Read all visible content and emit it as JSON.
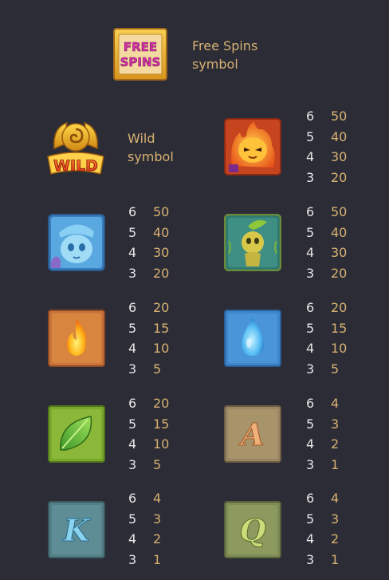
{
  "free_spins": {
    "icon_text_line1": "FREE",
    "icon_text_line2": "SPINS",
    "label_line1": "Free Spins",
    "label_line2": "symbol"
  },
  "wild": {
    "icon_text": "WILD",
    "label_line1": "Wild",
    "label_line2": "symbol"
  },
  "symbols": [
    {
      "id": "fire-spirit",
      "icon": "fire-spirit-icon",
      "color": "#f07a1c",
      "payouts": [
        {
          "count": "6",
          "value": "50"
        },
        {
          "count": "5",
          "value": "40"
        },
        {
          "count": "4",
          "value": "30"
        },
        {
          "count": "3",
          "value": "20"
        }
      ]
    },
    {
      "id": "water-spirit",
      "icon": "water-spirit-icon",
      "color": "#5ab4e8",
      "payouts": [
        {
          "count": "6",
          "value": "50"
        },
        {
          "count": "5",
          "value": "40"
        },
        {
          "count": "4",
          "value": "30"
        },
        {
          "count": "3",
          "value": "20"
        }
      ]
    },
    {
      "id": "leaf-spirit",
      "icon": "leaf-spirit-icon",
      "color": "#4a9a7a",
      "payouts": [
        {
          "count": "6",
          "value": "50"
        },
        {
          "count": "5",
          "value": "40"
        },
        {
          "count": "4",
          "value": "30"
        },
        {
          "count": "3",
          "value": "20"
        }
      ]
    },
    {
      "id": "fire",
      "icon": "fire-icon",
      "color": "#d8722c",
      "payouts": [
        {
          "count": "6",
          "value": "20"
        },
        {
          "count": "5",
          "value": "15"
        },
        {
          "count": "4",
          "value": "10"
        },
        {
          "count": "3",
          "value": "5"
        }
      ]
    },
    {
      "id": "water",
      "icon": "water-drop-icon",
      "color": "#3f8ed6",
      "payouts": [
        {
          "count": "6",
          "value": "20"
        },
        {
          "count": "5",
          "value": "15"
        },
        {
          "count": "4",
          "value": "10"
        },
        {
          "count": "3",
          "value": "5"
        }
      ]
    },
    {
      "id": "leaf",
      "icon": "leaf-icon",
      "color": "#8cb83a",
      "payouts": [
        {
          "count": "6",
          "value": "20"
        },
        {
          "count": "5",
          "value": "15"
        },
        {
          "count": "4",
          "value": "10"
        },
        {
          "count": "3",
          "value": "5"
        }
      ]
    },
    {
      "id": "a",
      "icon": "letter-a-icon",
      "letter": "A",
      "color": "#a8946a",
      "payouts": [
        {
          "count": "6",
          "value": "4"
        },
        {
          "count": "5",
          "value": "3"
        },
        {
          "count": "4",
          "value": "2"
        },
        {
          "count": "3",
          "value": "1"
        }
      ]
    },
    {
      "id": "k",
      "icon": "letter-k-icon",
      "letter": "K",
      "color": "#5e8d96",
      "payouts": [
        {
          "count": "6",
          "value": "4"
        },
        {
          "count": "5",
          "value": "3"
        },
        {
          "count": "4",
          "value": "2"
        },
        {
          "count": "3",
          "value": "1"
        }
      ]
    },
    {
      "id": "q",
      "icon": "letter-q-icon",
      "letter": "Q",
      "color": "#8c9a60",
      "payouts": [
        {
          "count": "6",
          "value": "4"
        },
        {
          "count": "5",
          "value": "3"
        },
        {
          "count": "4",
          "value": "2"
        },
        {
          "count": "3",
          "value": "1"
        }
      ]
    }
  ]
}
